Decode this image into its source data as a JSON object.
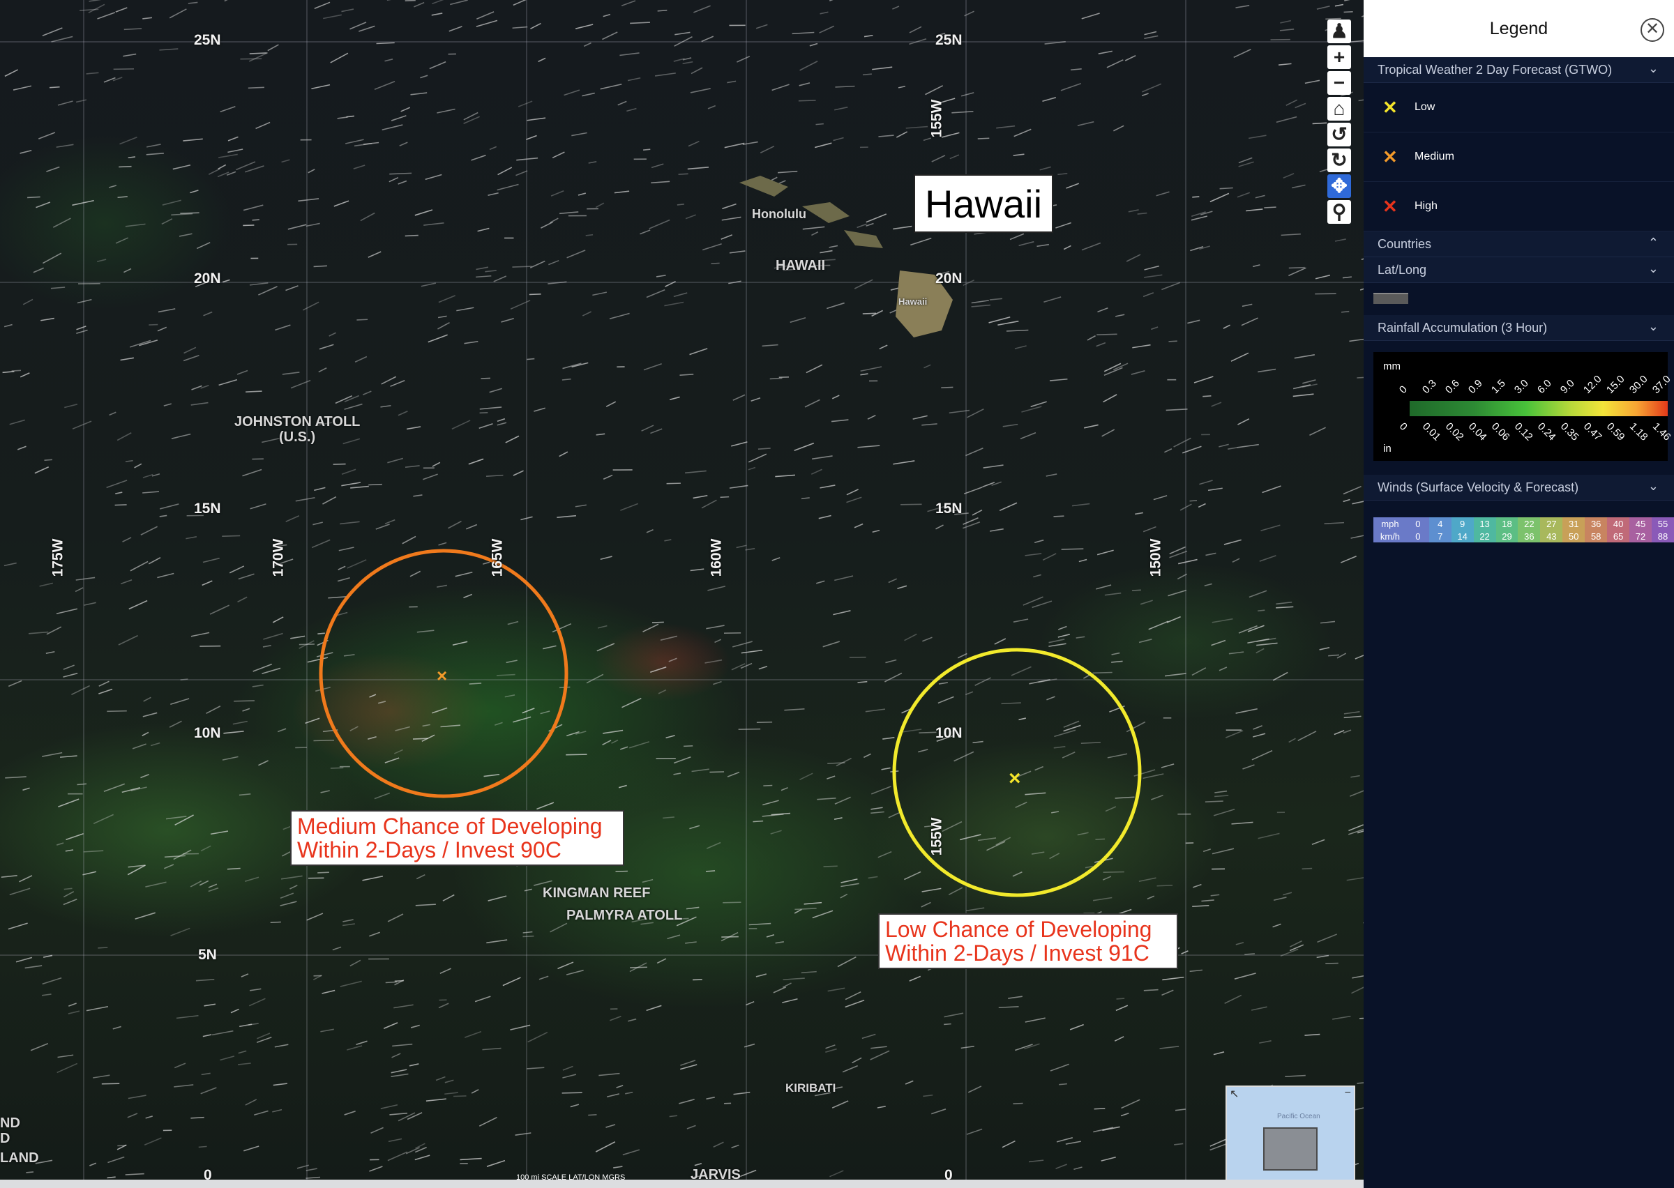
{
  "map": {
    "lat_labels": [
      {
        "text": "25N",
        "col": "left"
      },
      {
        "text": "25N",
        "col": "right"
      },
      {
        "text": "20N",
        "col": "left"
      },
      {
        "text": "20N",
        "col": "right"
      },
      {
        "text": "15N",
        "col": "left"
      },
      {
        "text": "15N",
        "col": "right"
      },
      {
        "text": "10N",
        "col": "left"
      },
      {
        "text": "10N",
        "col": "right"
      },
      {
        "text": "5N",
        "col": "left"
      },
      {
        "text": "0",
        "col": "left"
      },
      {
        "text": "0",
        "col": "right"
      }
    ],
    "lon_labels": [
      "175W",
      "170W",
      "165W",
      "160W",
      "155W",
      "150W",
      "155W",
      "155W"
    ],
    "places": {
      "honolulu": "Honolulu",
      "hawaii_state": "HAWAII",
      "hawaii_island": "Hawaii",
      "johnston": "JOHNSTON ATOLL",
      "johnston_sub": "(U.S.)",
      "kingman": "KINGMAN REEF",
      "palmyra": "PALMYRA ATOLL",
      "kiribati": "KIRIBATI",
      "jarvis": "JARVIS",
      "edge_1": "ND",
      "edge_2": "D",
      "edge_3": "LAND"
    },
    "region_title": "Hawaii",
    "annotations": [
      {
        "text": "Medium Chance of Developing\nWithin 2-Days / Invest 90C",
        "color": "#e8341c",
        "circle_color": "#f07a1c"
      },
      {
        "text": "Low Chance of Developing\nWithin 2-Days / Invest 91C",
        "color": "#e8341c",
        "circle_color": "#f2ea2c"
      }
    ],
    "toolbar": [
      "street-view",
      "zoom-in",
      "zoom-out",
      "home",
      "rotate-left",
      "rotate-right",
      "pan",
      "zoom-box"
    ],
    "scale_text": "100 mi     SCALE     LAT/LON     MGRS",
    "minimap_label": "Pacific\nOcean"
  },
  "legend": {
    "title": "Legend",
    "sections": {
      "gtwo": "Tropical Weather 2 Day Forecast (GTWO)",
      "countries": "Countries",
      "latlong": "Lat/Long",
      "rainfall": "Rainfall Accumulation (3 Hour)",
      "winds": "Winds (Surface Velocity & Forecast)"
    },
    "gtwo_items": [
      {
        "label": "Low",
        "color": "#f5e52a"
      },
      {
        "label": "Medium",
        "color": "#f39a2a"
      },
      {
        "label": "High",
        "color": "#e8341c"
      }
    ],
    "rain": {
      "unit_top": "mm",
      "unit_bottom": "in",
      "mm_ticks": [
        "0",
        "0.3",
        "0.6",
        "0.9",
        "1.5",
        "3.0",
        "6.0",
        "9.0",
        "12.0",
        "15.0",
        "30.0",
        "37.0"
      ],
      "in_ticks": [
        "0",
        "0.01",
        "0.02",
        "0.04",
        "0.06",
        "0.12",
        "0.24",
        "0.35",
        "0.47",
        "0.59",
        "1.18",
        "1.46"
      ]
    },
    "wind": {
      "mph_label": "mph",
      "kmh_label": "km/h",
      "mph": [
        "0",
        "4",
        "9",
        "13",
        "18",
        "22",
        "27",
        "31",
        "36",
        "40",
        "45",
        "55"
      ],
      "kmh": [
        "0",
        "7",
        "14",
        "22",
        "29",
        "36",
        "43",
        "50",
        "58",
        "65",
        "72",
        "88"
      ],
      "colors": [
        "#6a7ac8",
        "#5d8fd0",
        "#4fa8c8",
        "#4fb8a0",
        "#5cbe84",
        "#7cc26c",
        "#a8b85c",
        "#c8a058",
        "#c88460",
        "#c06a78",
        "#a860a0",
        "#8a5ab8"
      ]
    }
  }
}
